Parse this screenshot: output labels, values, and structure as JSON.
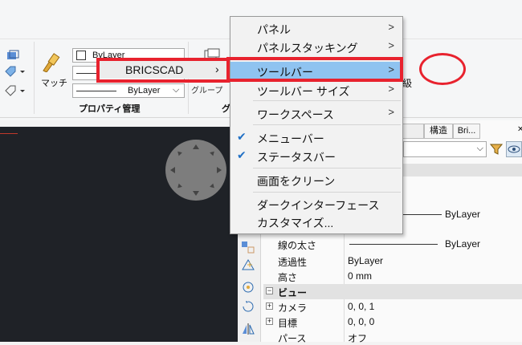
{
  "ribbon": {
    "match_label": "マッチ",
    "bylayer_top": "ByLayer",
    "bylayer_bottom": "ByLayer",
    "panel_title": "プロパティ管理",
    "panel_title_partial": "グ",
    "partial_text": "グループ",
    "kanji_partial": "級"
  },
  "menu": {
    "bricscad_label": "BRICSCAD",
    "bricscad_arrow": "›",
    "items": [
      {
        "label": "パネル",
        "arrow": ">"
      },
      {
        "label": "パネルスタッキング",
        "arrow": ">"
      },
      {
        "label": "ツールバー",
        "arrow": ">"
      },
      {
        "label": "ツールバー サイズ",
        "arrow": ">"
      },
      {
        "label": "ワークスペース",
        "arrow": ">"
      },
      {
        "label": "メニューバー",
        "check": "✔"
      },
      {
        "label": "ステータスバー",
        "check": "✔"
      },
      {
        "label": "画面をクリーン"
      },
      {
        "label": "ダークインターフェース"
      },
      {
        "label": "カスタマイズ..."
      }
    ]
  },
  "panel": {
    "tabs": [
      "構造",
      "Bri..."
    ],
    "rows": [
      {
        "label": "",
        "value": "ByLayer"
      },
      {
        "label": "線の太さ",
        "value": "ByLayer"
      },
      {
        "label": "透過性",
        "value": "ByLayer"
      },
      {
        "label": "高さ",
        "value": "0 mm"
      }
    ],
    "section_view": "ビュー",
    "view_rows": [
      {
        "label": "カメラ",
        "value": "0, 0, 1"
      },
      {
        "label": "目標",
        "value": "0, 0, 0"
      },
      {
        "label": "パース",
        "value": "オフ"
      }
    ]
  },
  "colors": {
    "highlight": "#8fc3f0",
    "annotation_red": "#e8222e",
    "canvas": "#1f2227"
  }
}
